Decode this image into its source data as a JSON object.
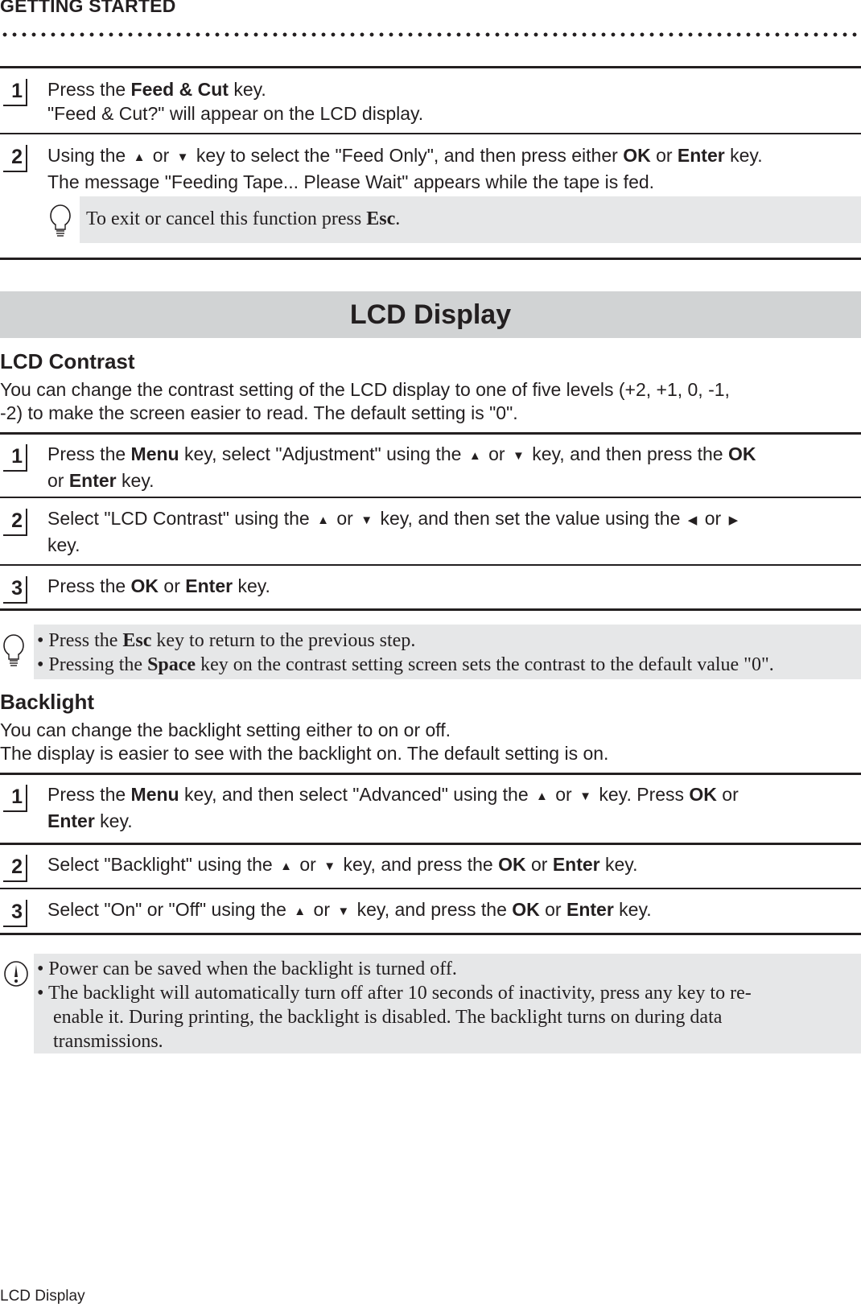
{
  "header": {
    "section_title": "GETTING STARTED"
  },
  "feed_steps": [
    {
      "number": "1",
      "line1": [
        {
          "t": "Press the "
        },
        {
          "b": "Feed & Cut"
        },
        {
          "t": " key."
        }
      ],
      "line2": "\"Feed & Cut?\" will appear on the LCD display."
    },
    {
      "number": "2",
      "line1_a": "Using the ",
      "up_arrow": "▲",
      "or": " or ",
      "down_arrow": "▼",
      "line1_b": " key to select the \"Feed Only\", and then press either ",
      "ok": "OK",
      "or2": " or ",
      "enter": "Enter",
      "key": " key.",
      "line2": "The message \"Feeding Tape... Please Wait\" appears while the tape is fed."
    }
  ],
  "feed_note": {
    "icon": "lightbulb-icon",
    "text_a": "To exit or cancel this function press ",
    "esc": "Esc",
    "text_b": "."
  },
  "band": {
    "title": "LCD Display"
  },
  "lcd_contrast": {
    "heading": "LCD Contrast",
    "intro_line1": "You can change the contrast setting of the LCD display to one of five levels (+2, +1, 0, -1,",
    "intro_line2": "-2) to make the screen easier to read. The default setting is \"0\".",
    "steps": [
      {
        "number": "1",
        "a": "Press the ",
        "menu": "Menu",
        "b": " key, select \"Adjustment\" using the ",
        "up": "▲",
        "or": " or ",
        "down": "▼",
        "c": " key, and then press the ",
        "ok": "OK",
        "d": "or ",
        "enter": "Enter",
        "e": " key."
      },
      {
        "number": "2",
        "a": "Select \"LCD Contrast\" using the ",
        "up": "▲",
        "or": " or ",
        "down": "▼",
        "b": " key, and then set the value using the ",
        "left": "◀",
        "or2": " or ",
        "right": "▶",
        "c": "key."
      },
      {
        "number": "3",
        "a": "Press the ",
        "ok": "OK",
        "or": " or ",
        "enter": "Enter",
        "b": " key."
      }
    ],
    "note": {
      "icon": "lightbulb-icon",
      "bullet1_a": "• Press the ",
      "bullet1_esc": "Esc",
      "bullet1_b": " key to return to the previous step.",
      "bullet2_a": "• Pressing the ",
      "bullet2_space": "Space",
      "bullet2_b": " key on the contrast setting screen sets the contrast to the default value \"0\"."
    }
  },
  "backlight": {
    "heading": "Backlight",
    "intro_line1": "You can change the backlight setting either to on or off.",
    "intro_line2": "The display is easier to see with the backlight on. The default setting is on.",
    "steps": [
      {
        "number": "1",
        "a": "Press the ",
        "menu": "Menu",
        "b": " key, and then select \"Advanced\" using the ",
        "up": "▲",
        "or": " or ",
        "down": "▼",
        "c": " key. Press ",
        "ok": "OK",
        "d": " or",
        "enter": "Enter",
        "e": " key."
      },
      {
        "number": "2",
        "a": "Select \"Backlight\" using the ",
        "up": "▲",
        "or": " or ",
        "down": "▼",
        "b": " key, and press the ",
        "ok": "OK",
        "or2": " or ",
        "enter": "Enter",
        "c": " key."
      },
      {
        "number": "3",
        "a": "Select \"On\" or \"Off\" using the ",
        "up": "▲",
        "or": " or ",
        "down": "▼",
        "b": " key, and press the ",
        "ok": "OK",
        "or2": " or ",
        "enter": "Enter",
        "c": " key."
      }
    ],
    "note": {
      "icon": "caution-icon",
      "bullet1": "• Power can be saved when the backlight is turned off.",
      "bullet2_line1": "• The backlight will automatically turn off after 10 seconds of inactivity, press any key to re-",
      "bullet2_line2": "enable it. During printing, the backlight is disabled. The backlight turns on during data",
      "bullet2_line3": "transmissions."
    }
  },
  "footer": {
    "label": "LCD Display"
  }
}
